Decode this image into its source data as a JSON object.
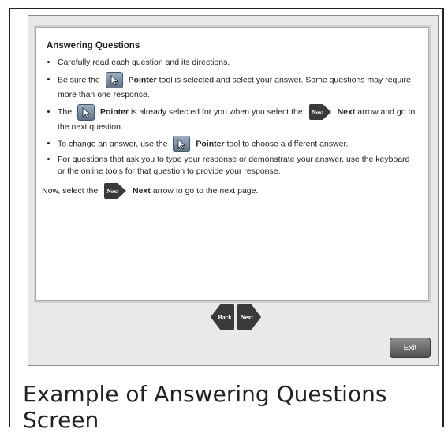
{
  "content": {
    "heading": "Answering Questions",
    "bullet1": "Carefully read each question and its directions.",
    "bullet2_pre": "Be sure the",
    "bullet2_bold": "Pointer",
    "bullet2_post": "tool is selected and select your answer. Some questions may require more than one response.",
    "bullet3_pre": "The",
    "bullet3_bold": "Pointer",
    "bullet3_mid": "is already selected for you when you select the",
    "bullet3_bold2": "Next",
    "bullet3_post": "arrow and go to the next question.",
    "bullet4_pre": "To change an answer, use the",
    "bullet4_bold": "Pointer",
    "bullet4_post": "tool to choose a different answer.",
    "bullet5": "For questions that ask you to type your response or demonstrate your answer, use the keyboard or the online tools for that question to provide your response.",
    "closing_pre": "Now, select the",
    "closing_bold": "Next",
    "closing_post": "arrow to go to the next page."
  },
  "icons": {
    "next_label": "Next",
    "back_label": "Back"
  },
  "footer": {
    "exit_label": "Exit"
  },
  "caption": "Example of Answering Questions Screen"
}
